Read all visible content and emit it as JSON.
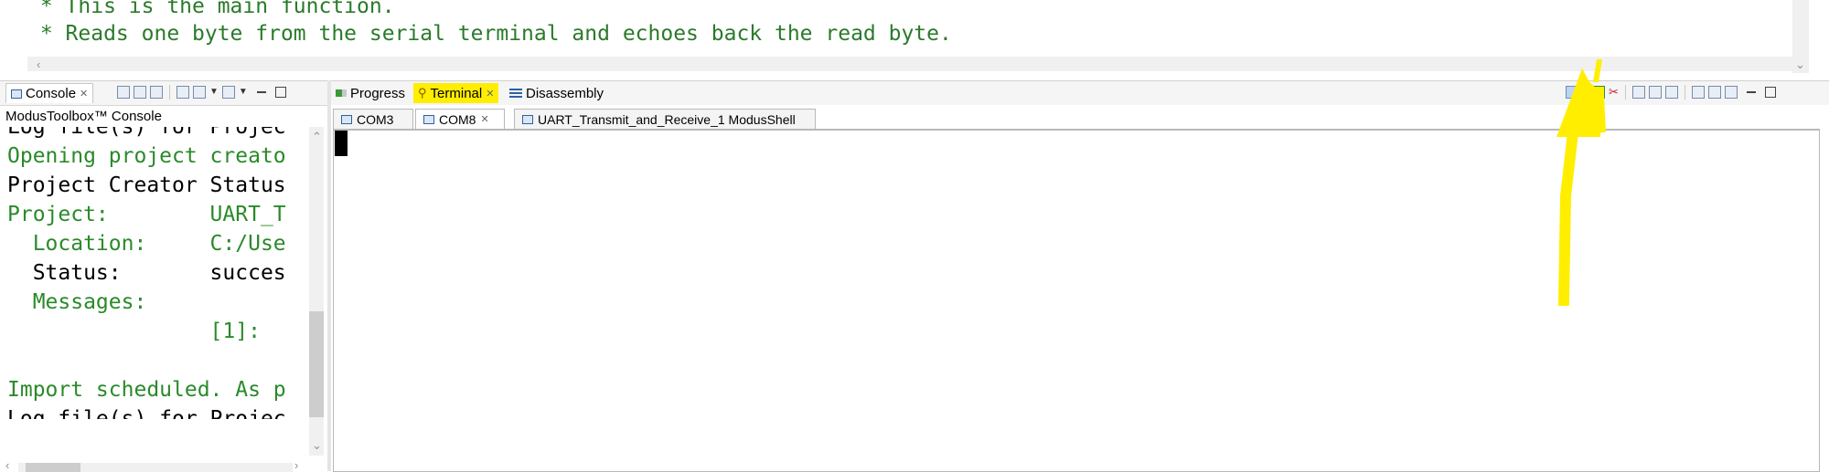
{
  "editor": {
    "lines": [
      " * This is the main function.",
      " * Reads one byte from the serial terminal and echoes back the read byte."
    ]
  },
  "console_panel": {
    "tab_label": "Console",
    "title": "ModusToolbox™ Console",
    "lines": [
      {
        "text": "Log file(s) for Projec",
        "color": "black"
      },
      {
        "text": "Opening project creato",
        "color": "green"
      },
      {
        "text": "Project Creator Status",
        "color": "black"
      },
      {
        "text": "Project:        UART_T",
        "color": "green"
      },
      {
        "text": "  Location:     C:/Use",
        "color": "green"
      },
      {
        "text": "  Status:       succes",
        "color": "black"
      },
      {
        "text": "  Messages:",
        "color": "green"
      },
      {
        "text": "                [1]:",
        "color": "green"
      },
      {
        "text": "",
        "color": "black"
      },
      {
        "text": "Import scheduled. As p",
        "color": "green"
      },
      {
        "text": "Log file(s) for Projec",
        "color": "black"
      }
    ]
  },
  "terminal_panel": {
    "tabs": [
      {
        "label": "Progress",
        "icon": "progress-icon"
      },
      {
        "label": "Terminal",
        "icon": "terminal-icon",
        "highlighted": true
      },
      {
        "label": "Disassembly",
        "icon": "disassembly-icon"
      }
    ],
    "sessions": [
      {
        "label": "COM3"
      },
      {
        "label": "COM8",
        "active": true
      },
      {
        "label": "UART_Transmit_and_Receive_1 ModusShell"
      }
    ]
  },
  "colors": {
    "highlight": "#ffee00",
    "console_green": "#2a8a2a"
  }
}
